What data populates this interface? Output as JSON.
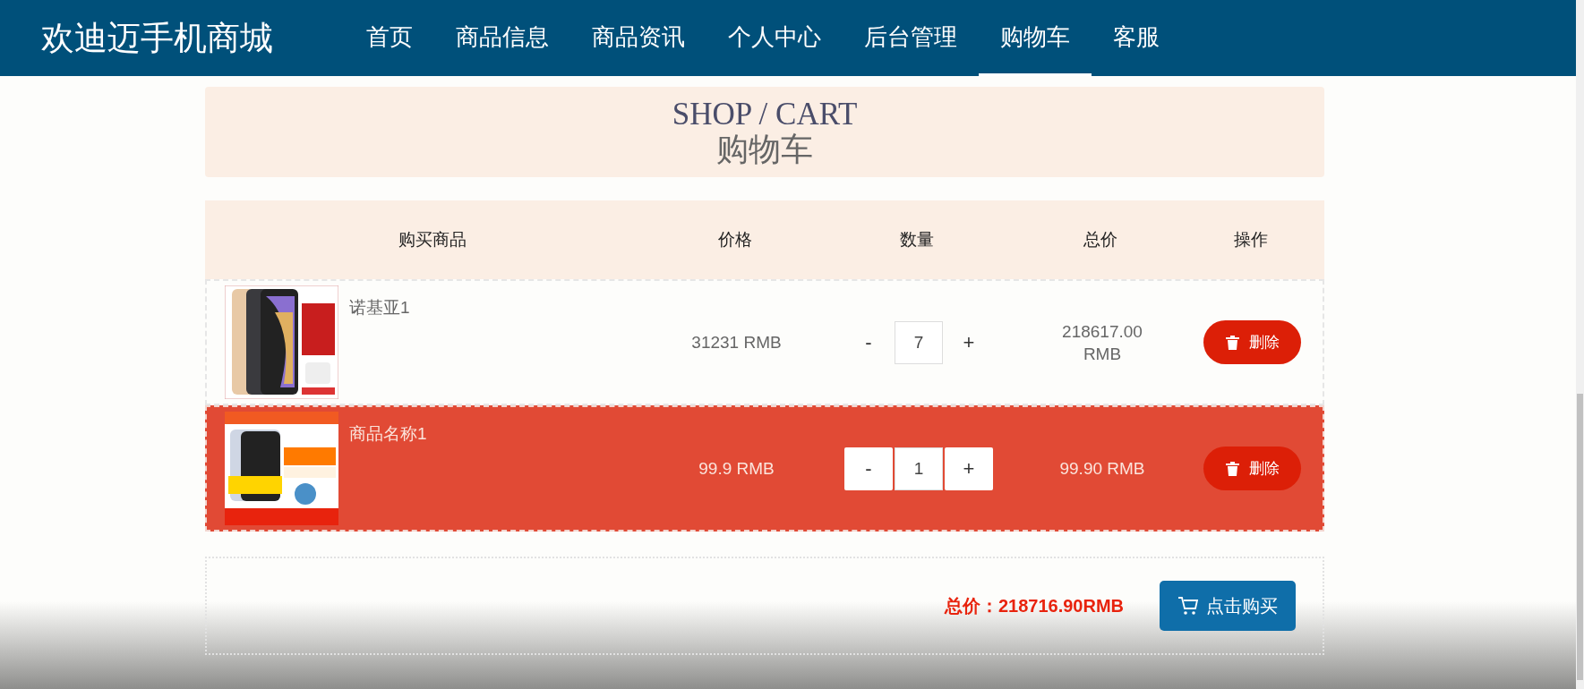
{
  "header": {
    "brand": "欢迪迈手机商城",
    "nav": [
      {
        "label": "首页",
        "selected": false
      },
      {
        "label": "商品信息",
        "selected": false
      },
      {
        "label": "商品资讯",
        "selected": false
      },
      {
        "label": "个人中心",
        "selected": false
      },
      {
        "label": "后台管理",
        "selected": false
      },
      {
        "label": "购物车",
        "selected": true
      },
      {
        "label": "客服",
        "selected": false
      }
    ]
  },
  "banner": {
    "title": "SHOP / CART",
    "subtitle": "购物车"
  },
  "table": {
    "columns": [
      "购买商品",
      "价格",
      "数量",
      "总价",
      "操作"
    ],
    "rows": [
      {
        "name": "诺基亚1",
        "price": "31231 RMB",
        "minus": "-",
        "quantity": "7",
        "plus": "+",
        "total": "218617.00 RMB",
        "action": "删除",
        "selected": false
      },
      {
        "name": "商品名称1",
        "price": "99.9 RMB",
        "minus": "-",
        "quantity": "1",
        "plus": "+",
        "total": "99.90 RMB",
        "action": "删除",
        "selected": true
      }
    ]
  },
  "summary": {
    "label": "总价：",
    "value": "218716.90RMB",
    "button": "点击购买"
  }
}
